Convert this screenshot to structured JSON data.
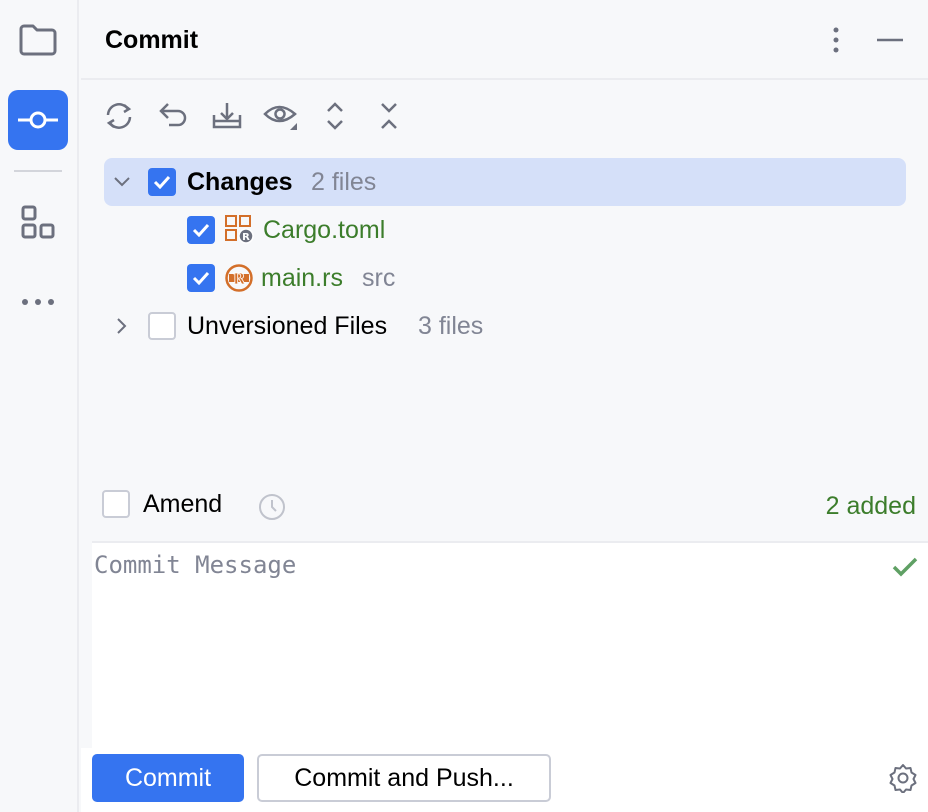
{
  "toolstrip": {
    "items": [
      {
        "name": "project",
        "icon": "folder-icon",
        "active": false
      },
      {
        "name": "commit",
        "icon": "commit-icon",
        "active": true
      },
      {
        "name": "structure",
        "icon": "structure-icon",
        "active": false
      },
      {
        "name": "more",
        "icon": "more-horizontal-icon",
        "active": false
      }
    ]
  },
  "header": {
    "title": "Commit",
    "options_icon": "more-vertical-icon",
    "minimize_icon": "minimize-icon"
  },
  "toolbar": {
    "buttons": [
      {
        "name": "refresh",
        "icon": "refresh-icon"
      },
      {
        "name": "rollback",
        "icon": "rollback-icon"
      },
      {
        "name": "shelve",
        "icon": "shelve-icon"
      },
      {
        "name": "view-options",
        "icon": "eye-icon"
      },
      {
        "name": "expand-all",
        "icon": "expand-all-icon"
      },
      {
        "name": "collapse-all",
        "icon": "collapse-all-icon"
      }
    ]
  },
  "tree": {
    "changes": {
      "label": "Changes",
      "count": "2 files",
      "checked": true,
      "expanded": true,
      "files": [
        {
          "name": "Cargo.toml",
          "path": "",
          "icon": "cargo-toml-icon",
          "checked": true
        },
        {
          "name": "main.rs",
          "path": "src",
          "icon": "rust-file-icon",
          "checked": true
        }
      ]
    },
    "unversioned": {
      "label": "Unversioned Files",
      "count": "3 files",
      "checked": false,
      "expanded": false
    }
  },
  "amend": {
    "label": "Amend",
    "checked": false,
    "history_icon": "clock-icon",
    "status": "2 added"
  },
  "message": {
    "placeholder": "Commit Message",
    "value": ""
  },
  "actions": {
    "commit_label": "Commit",
    "commit_push_label": "Commit and Push...",
    "settings_icon": "gear-icon"
  },
  "colors": {
    "accent": "#3574f0",
    "selection": "#d5e0f9",
    "added": "#3c7d2b",
    "muted": "#818594",
    "rust_orange": "#d36f2a"
  }
}
